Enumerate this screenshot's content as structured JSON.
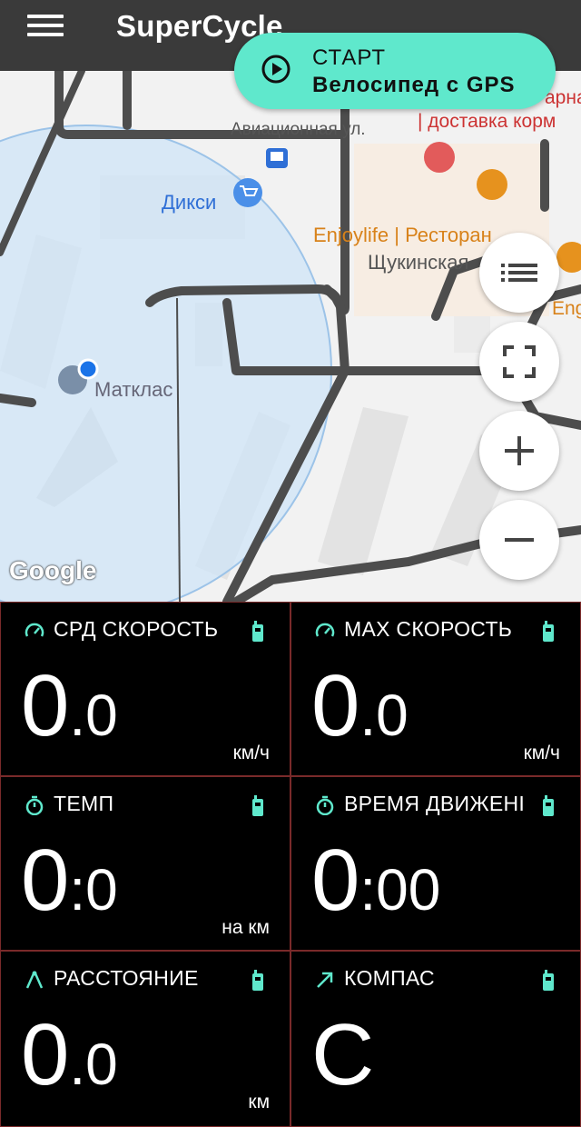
{
  "app": {
    "title": "SuperCycle"
  },
  "start_button": {
    "line1": "СТАРТ",
    "line2": "Велосипед с GPS"
  },
  "map": {
    "labels": {
      "street": "Авиационная ул.",
      "shop": "Дикси",
      "restaurant": "Enjoylife | Ресторан",
      "metro": "Щукинская",
      "school": "Матклас",
      "top_right1": "арна",
      "top_right2": "| доставка корм",
      "edge_right": "Eng",
      "watermark": "Google"
    },
    "colors": {
      "accuracy_circle": "#cfe4f7",
      "location_dot": "#1a73e8",
      "roads": "#4d4d4d"
    }
  },
  "fabs": [
    "list-icon",
    "fullscreen-icon",
    "zoom-in-icon",
    "zoom-out-icon"
  ],
  "panels": {
    "avg_speed": {
      "label": "СРД СКОРОСТЬ",
      "big": "0",
      "small": ".0",
      "unit": "км/ч",
      "icon": "speedometer-icon"
    },
    "max_speed": {
      "label": "МАХ СКОРОСТЬ",
      "big": "0",
      "small": ".0",
      "unit": "км/ч",
      "icon": "speedometer-icon"
    },
    "pace": {
      "label": "ТЕМП",
      "big": "0",
      "small": ":0",
      "unit": "на км",
      "icon": "stopwatch-icon"
    },
    "moving_time": {
      "label": "ВРЕМЯ ДВИЖЕНІ",
      "big": "0",
      "small": ":00",
      "unit": "",
      "icon": "stopwatch-icon"
    },
    "distance": {
      "label": "РАССТОЯНИЕ",
      "big": "0",
      "small": ".0",
      "unit": "км",
      "icon": "compass-drafting-icon"
    },
    "compass": {
      "label": "КОМПАС",
      "big": "С",
      "small": "",
      "unit": "",
      "icon": "arrow-icon"
    }
  },
  "accent_color": "#5fe8cc"
}
